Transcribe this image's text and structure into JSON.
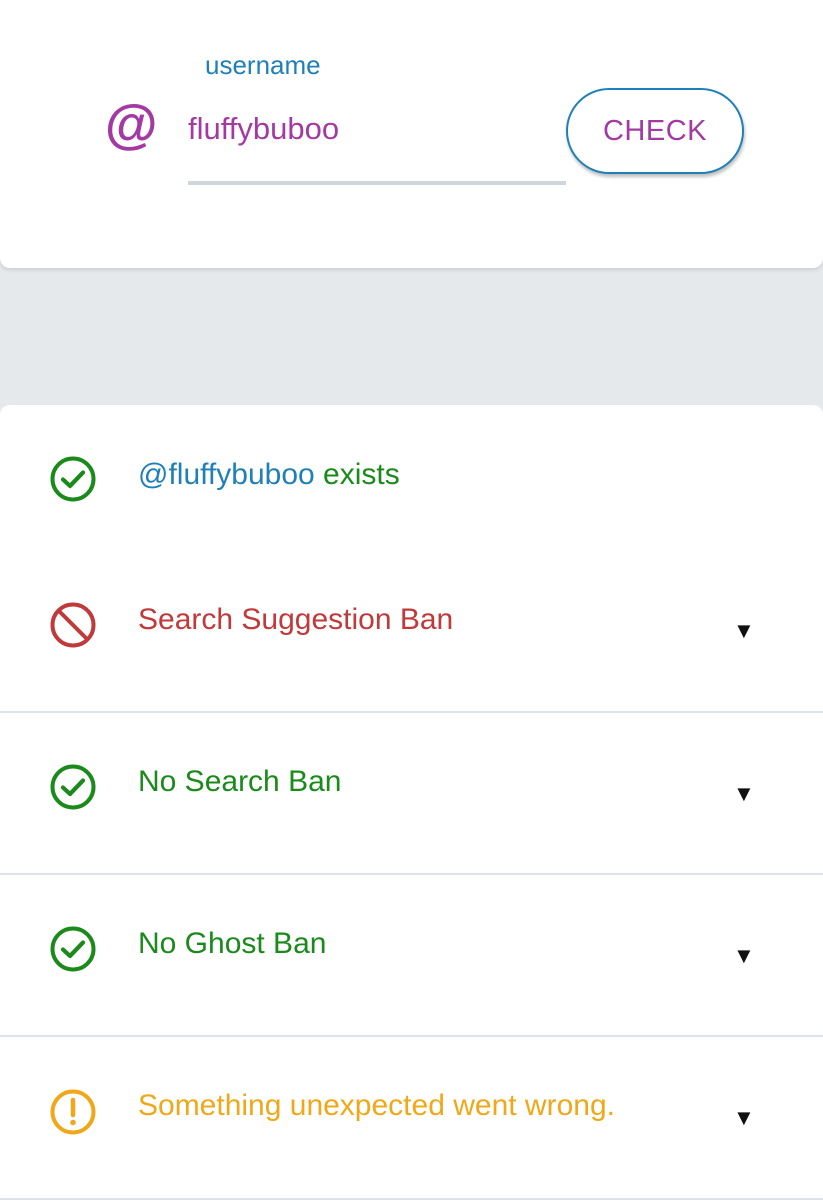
{
  "search": {
    "at_symbol": "@",
    "label": "username",
    "value": "fluffybuboo",
    "button_label": "CHECK"
  },
  "results": {
    "exists": {
      "username": "@fluffybuboo",
      "suffix": " exists",
      "status": "ok"
    },
    "items": [
      {
        "label": "Search Suggestion Ban",
        "status": "banned",
        "icon": "ban-icon",
        "expand": "▼"
      },
      {
        "label": "No Search Ban",
        "status": "ok",
        "icon": "check-circle-icon",
        "expand": "▼"
      },
      {
        "label": "No Ghost Ban",
        "status": "ok",
        "icon": "check-circle-icon",
        "expand": "▼"
      },
      {
        "label": "Something unexpected went wrong.",
        "status": "error",
        "icon": "exclamation-circle-icon",
        "expand": "▼"
      }
    ]
  },
  "colors": {
    "accent_purple": "#a33aa3",
    "link_blue": "#1f80b8",
    "ok_green": "#1a8a1a",
    "ban_red": "#c0393b",
    "warn_orange": "#f0a81a"
  }
}
